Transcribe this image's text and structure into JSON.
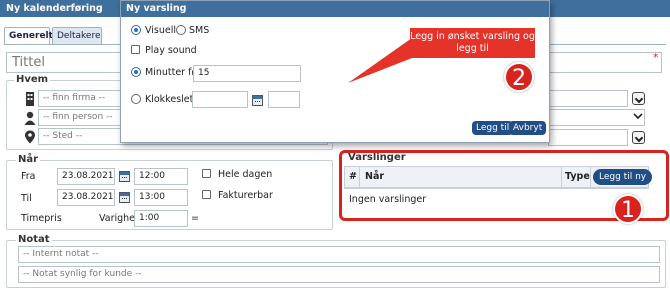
{
  "window": {
    "title": "Ny kalenderføring"
  },
  "tabs": [
    {
      "label": "Generelt"
    },
    {
      "label": "Deltakere"
    }
  ],
  "title_field": {
    "placeholder": "Tittel"
  },
  "hvem": {
    "legend": "Hvem",
    "firma_placeholder": "-- finn firma --",
    "person_placeholder": "-- finn person --",
    "sted_placeholder": "-- Sted --"
  },
  "naar": {
    "legend": "Når",
    "fra_label": "Fra",
    "fra_date": "23.08.2021",
    "fra_time": "12:00",
    "til_label": "Til",
    "til_date": "23.08.2021",
    "til_time": "13:00",
    "hele_dagen": "Hele dagen",
    "fakturerbar": "Fakturerbar",
    "timepris_label": "Timepris",
    "varighet_label": "Varighet",
    "varighet_value": "1:00",
    "equals": "="
  },
  "notat": {
    "legend": "Notat",
    "internt_placeholder": "-- Internt notat --",
    "synlig_placeholder": "-- Notat synlig for kunde --"
  },
  "varslinger": {
    "legend": "Varslinger",
    "columns": {
      "num": "#",
      "naar": "Når",
      "type": "Type"
    },
    "add_button": "Legg til ny",
    "empty_text": "Ingen varslinger"
  },
  "popup": {
    "title": "Ny varsling",
    "visuell_label": "Visuell",
    "sms_label": "SMS",
    "play_sound_label": "Play sound",
    "minutter_label": "Minutter før",
    "minutter_value": "15",
    "klokkeslett_label": "Klokkeslett",
    "legg_til": "Legg til",
    "avbryt": "Avbryt"
  },
  "annotations": {
    "callout_text": "Legg in ønsket varsling og legg til",
    "badge_1": "1",
    "badge_2": "2",
    "color": "#d9231f"
  },
  "colors": {
    "header": "#3f6f9c",
    "button": "#1f4f86"
  }
}
